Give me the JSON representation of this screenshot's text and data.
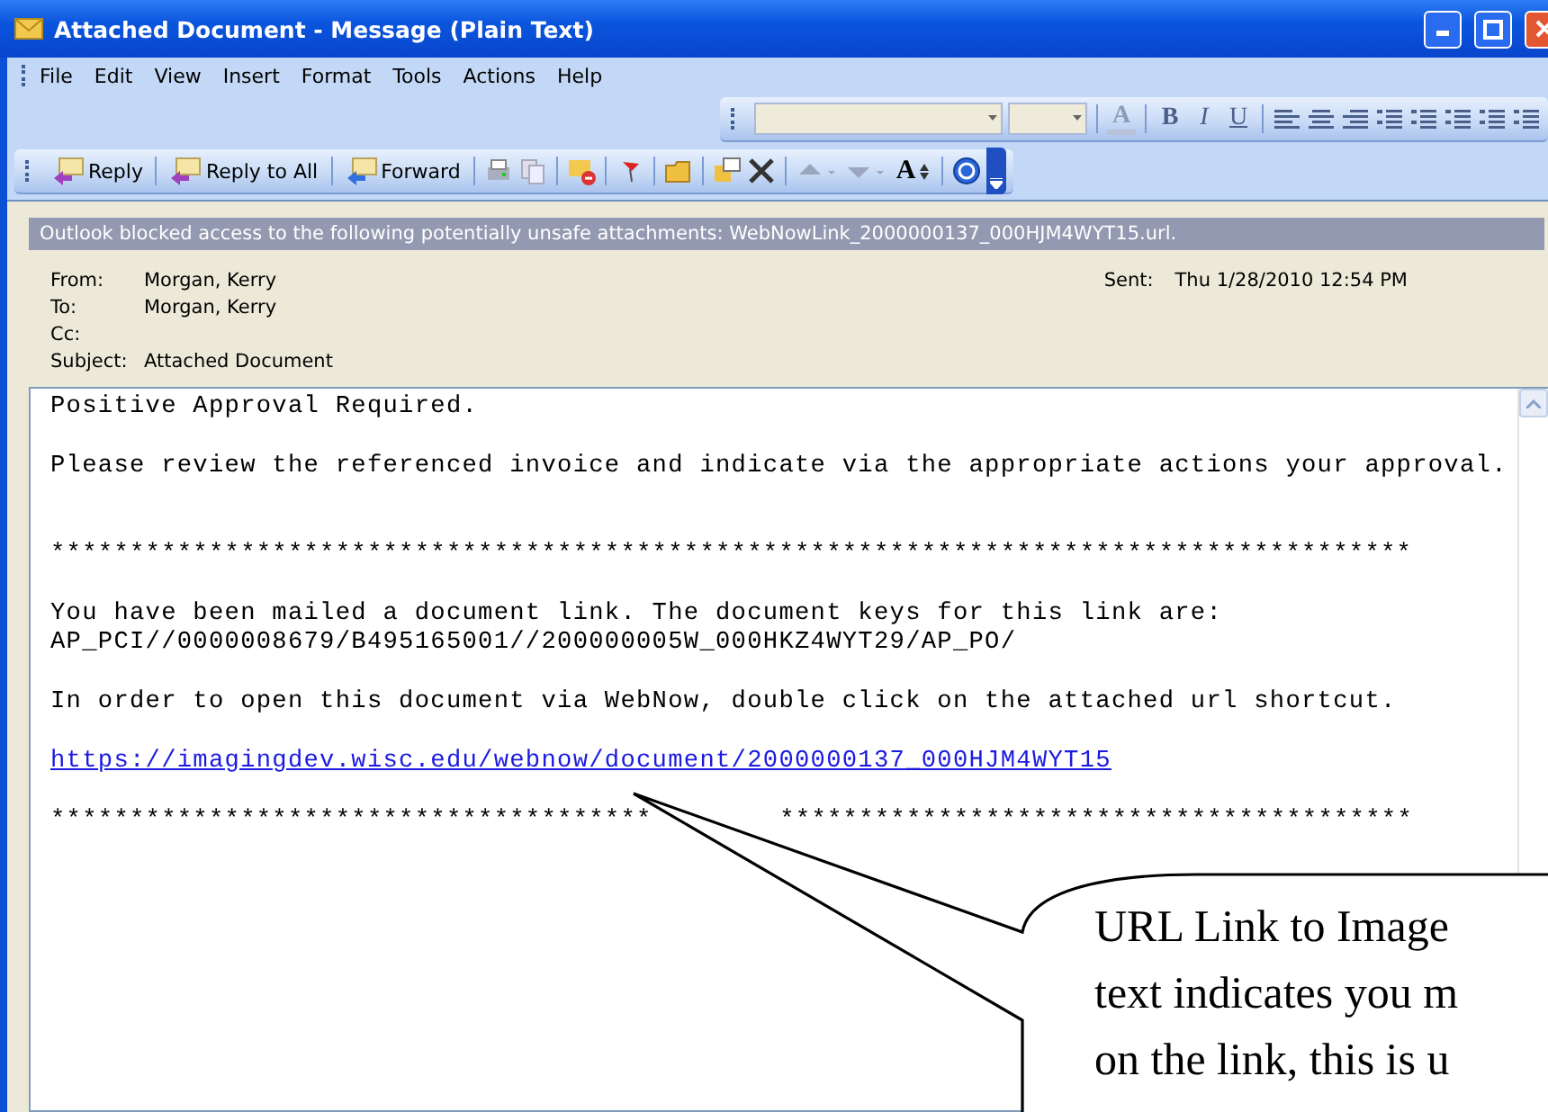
{
  "window": {
    "title": "Attached Document - Message (Plain Text)"
  },
  "menu": [
    {
      "label": "File"
    },
    {
      "label": "Edit"
    },
    {
      "label": "View"
    },
    {
      "label": "Insert"
    },
    {
      "label": "Format"
    },
    {
      "label": "Tools"
    },
    {
      "label": "Actions"
    },
    {
      "label": "Help"
    }
  ],
  "format_toolbar": {
    "letters": [
      {
        "kind": "color",
        "label": "A"
      },
      {
        "kind": "bold",
        "label": "B"
      },
      {
        "kind": "italic",
        "label": "I"
      },
      {
        "kind": "underline",
        "label": "U"
      }
    ]
  },
  "standard_toolbar": {
    "buttons": [
      {
        "label": "Reply"
      },
      {
        "label": "Reply to All"
      },
      {
        "label": "Forward"
      }
    ],
    "font_size_label": "A"
  },
  "infobar": {
    "text": "Outlook blocked access to the following potentially unsafe attachments: WebNowLink_2000000137_000HJM4WYT15.url."
  },
  "header": {
    "fields": [
      {
        "label": "From:",
        "value": "Morgan, Kerry"
      },
      {
        "label": "To:",
        "value": "Morgan, Kerry"
      },
      {
        "label": "Cc:"
      },
      {
        "label": "Subject:",
        "value": "Attached Document"
      }
    ],
    "sent": {
      "label": "Sent:",
      "value": "Thu 1/28/2010 12:54 PM"
    }
  },
  "body": [
    {
      "kind": "text",
      "lines": [
        "Positive Approval Required."
      ]
    },
    {
      "kind": "text",
      "lines": [
        "Please review the referenced invoice and indicate via the appropriate actions your approval."
      ]
    },
    {
      "kind": "rule",
      "lines": [
        "**************************************************************************************"
      ]
    },
    {
      "kind": "text",
      "lines": [
        "You have been mailed a document link. The document keys for this link are:",
        "AP_PCI//0000008679/B495165001//200000005W_000HKZ4WYT29/AP_PO/"
      ]
    },
    {
      "kind": "text",
      "lines": [
        "In order to open this document via WebNow, double click on the attached url shortcut."
      ]
    },
    {
      "kind": "link",
      "lines": [
        "https://imagingdev.wisc.edu/webnow/document/2000000137_000HJM4WYT15"
      ]
    },
    {
      "kind": "split_rule",
      "lines": [
        "**************************************",
        "****************************************"
      ]
    }
  ],
  "callout": {
    "lines": [
      "URL Link to Image",
      "text indicates you m",
      "on the link, this is u"
    ]
  }
}
